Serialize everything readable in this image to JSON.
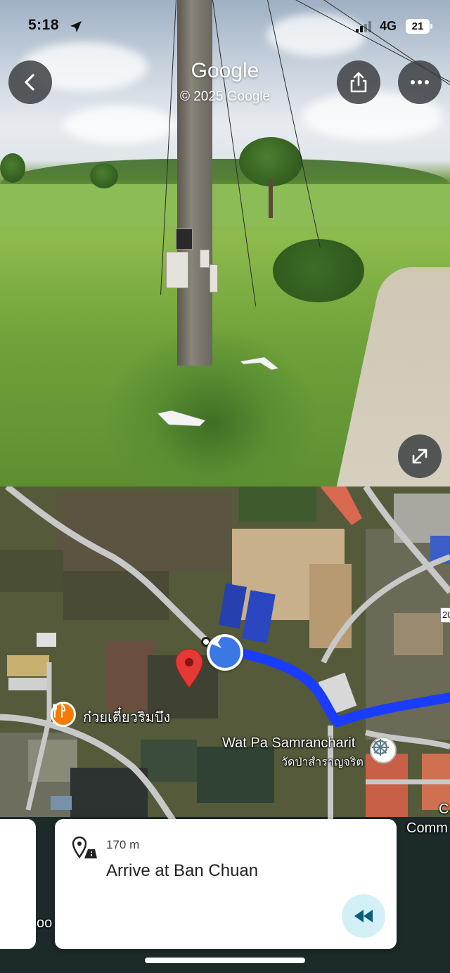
{
  "status_bar": {
    "time": "5:18",
    "network": "4G",
    "battery": "21"
  },
  "street_view": {
    "title": "Google",
    "copyright": "© 2025 Google",
    "back_icon": "chevron-left-icon",
    "share_icon": "share-icon",
    "more_icon": "more-horizontal-icon",
    "expand_icon": "expand-icon"
  },
  "map": {
    "labels": {
      "restaurant": "ก๋วยเตี๋ยวริมบึง",
      "temple_en": "Wat Pa Samrancharit",
      "temple_th": "วัดป่าสำราญจริต",
      "edge_c": "C",
      "edge_comm": "Comm",
      "edge_oo": "oo",
      "road_badge": "20"
    },
    "colors": {
      "route": "#1a3cff",
      "pin": "#e53935",
      "restaurant_marker": "#f57c00",
      "temple_marker": "#ffffff"
    }
  },
  "navigation": {
    "distance": "170 m",
    "instruction": "Arrive at Ban Chuan",
    "instruction_icon": "arrive-destination-icon",
    "rewind_icon": "rewind-icon"
  }
}
